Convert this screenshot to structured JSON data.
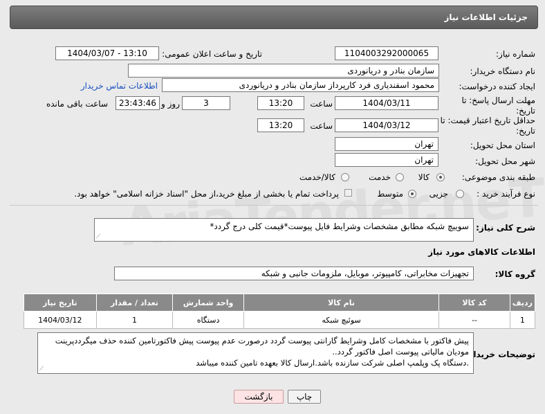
{
  "header": {
    "title": "جزئیات اطلاعات نیاز"
  },
  "watermark": {
    "text": "AriaTender.neT"
  },
  "form": {
    "need_number": {
      "label": "شماره نیاز:",
      "value": "1104003292000065"
    },
    "announce_datetime": {
      "label": "تاریخ و ساعت اعلان عمومی:",
      "value": "1404/03/07 - 13:10"
    },
    "buyer_org": {
      "label": "نام دستگاه خریدار:",
      "value": "سازمان بنادر و دریانوردی"
    },
    "requester": {
      "label": "ایجاد کننده درخواست:",
      "value": "محمود اسفندیاری فرد کارپرداز سازمان بنادر و دریانوردی",
      "contact_link": "اطلاعات تماس خریدار"
    },
    "response_deadline": {
      "label": "مهلت ارسال پاسخ: تا تاریخ:",
      "date": "1404/03/11",
      "time_label": "ساعت",
      "time": "13:20",
      "days": "3",
      "days_label": "روز و",
      "remaining": "23:43:46",
      "remaining_label": "ساعت باقی مانده"
    },
    "price_validity": {
      "label": "حداقل تاریخ اعتبار قیمت: تا تاریخ:",
      "date": "1404/03/12",
      "time_label": "ساعت",
      "time": "13:20"
    },
    "delivery_province": {
      "label": "استان محل تحویل:",
      "value": "تهران"
    },
    "delivery_city": {
      "label": "شهر محل تحویل:",
      "value": "تهران"
    },
    "category": {
      "label": "طبقه بندی موضوعی:",
      "options": [
        "کالا",
        "خدمت",
        "کالا/خدمت"
      ],
      "selected": "کالا"
    },
    "purchase_type": {
      "label": "نوع فرآیند خرید :",
      "options": [
        "جزیی",
        "متوسط"
      ],
      "selected": "متوسط",
      "note": "پرداخت تمام یا بخشی از مبلغ خرید،از محل \"اسناد خزانه اسلامی\" خواهد بود."
    }
  },
  "description": {
    "label": "شرح کلی نیاز:",
    "value": "سوییچ شبکه مطابق مشخصات وشرایط فایل پیوست*قیمت کلی درج گردد*"
  },
  "goods_section": {
    "title": "اطلاعات کالاهای مورد نیاز"
  },
  "goods_group": {
    "label": "گروه کالا:",
    "value": "تجهیزات مخابراتی، کامپیوتر، موبایل، ملزومات جانبی و شبکه"
  },
  "table": {
    "headers": [
      "ردیف",
      "کد کالا",
      "نام کالا",
      "واحد شمارش",
      "تعداد / مقدار",
      "تاریخ نیاز"
    ],
    "rows": [
      [
        "1",
        "--",
        "سوئیچ شبکه",
        "دستگاه",
        "1",
        "1404/03/12"
      ]
    ]
  },
  "buyer_notes": {
    "label": "توضیحات خریدار:",
    "lines": [
      "پیش فاکتور با مشخصات کامل وشرایط گارانتی پیوست گردد درصورت عدم پیوست پیش فاکتورتامین کننده حذف میگردد‌پرینت",
      "مودیان مالیاتی پیوست اصل فاکتور گردد..",
      ".دستگاه پک وپلمپ اصلی شرکت سازنده باشد.ارسال کالا بعهده تامین کننده میباشد"
    ]
  },
  "buttons": {
    "print": "چاپ",
    "back": "بازگشت"
  }
}
